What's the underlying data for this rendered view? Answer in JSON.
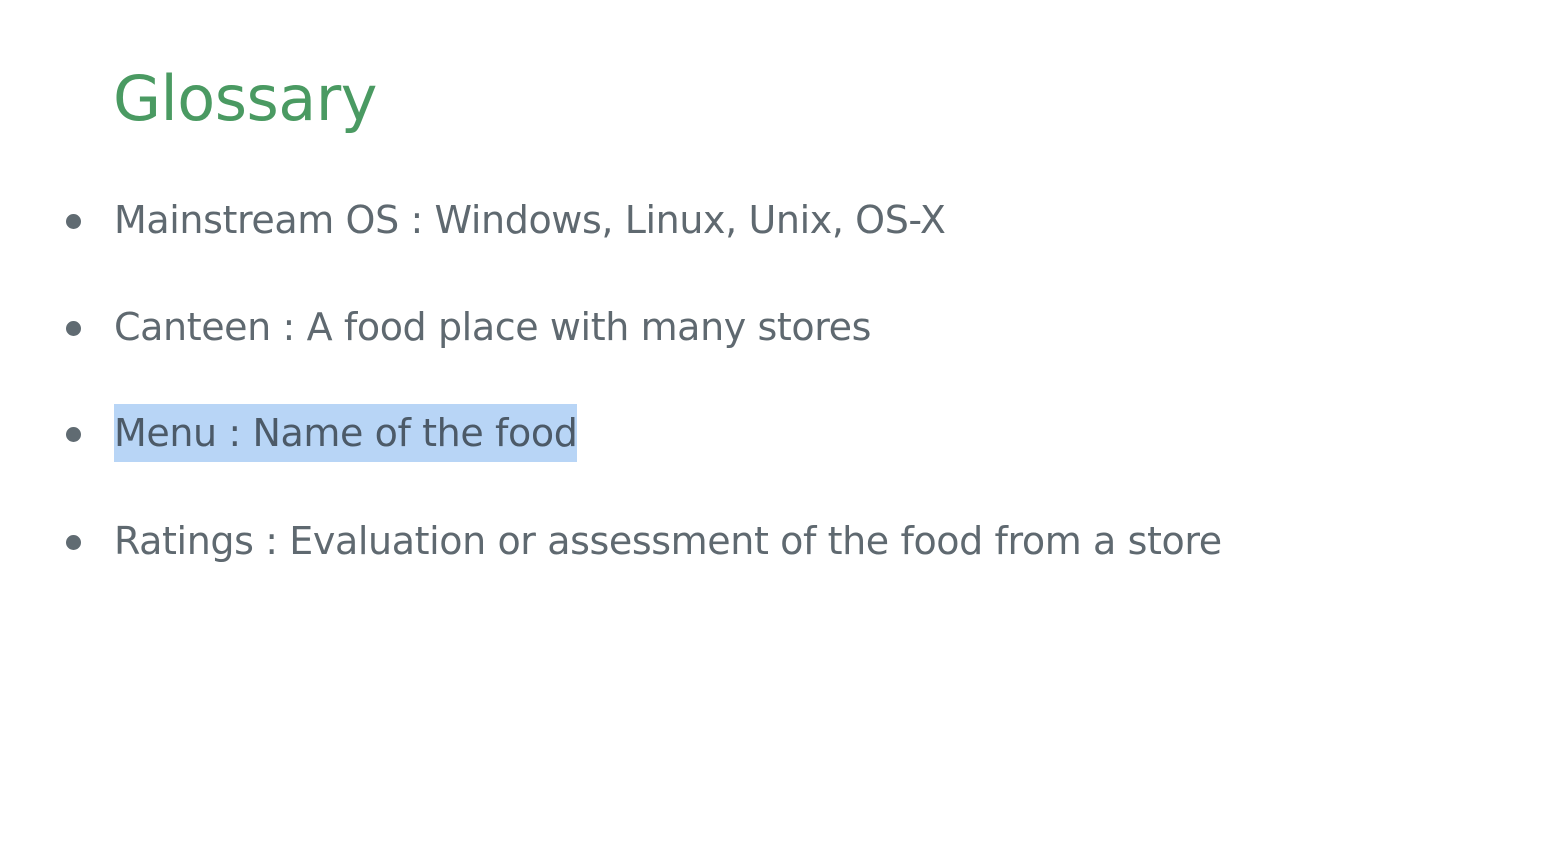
{
  "slide": {
    "title": "Glossary",
    "bullets": [
      {
        "text": "Mainstream OS : Windows, Linux, Unix, OS-X",
        "selected": false
      },
      {
        "text": "Canteen : A food place with many stores",
        "selected": false
      },
      {
        "text": "Menu : Name of the food",
        "selected": true
      },
      {
        "text": "Ratings : Evaluation or assessment of the food from a store",
        "selected": false
      }
    ]
  },
  "colors": {
    "title": "#4a9a62",
    "body_text": "#5f6970",
    "selection_highlight": "#b8d5f6",
    "background": "#ffffff"
  }
}
